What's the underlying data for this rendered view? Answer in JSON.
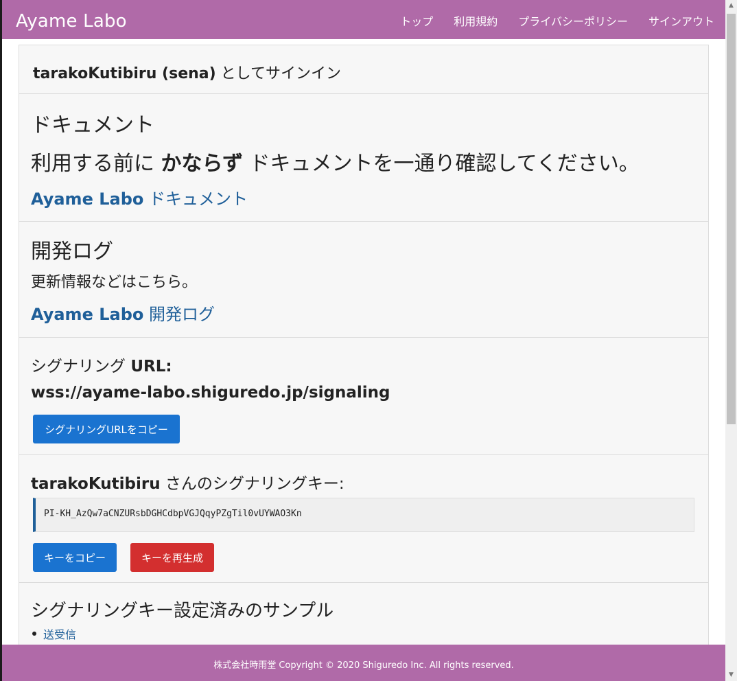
{
  "navbar": {
    "brand": "Ayame Labo",
    "links": [
      "トップ",
      "利用規約",
      "プライバシーポリシー",
      "サインアウト"
    ]
  },
  "header": {
    "user": "tarakoKutibiru (sena)",
    "suffix": " としてサインイン"
  },
  "docs": {
    "title": "ドキュメント",
    "desc_before": "利用する前に ",
    "desc_bold": "かならず",
    "desc_after": " ドキュメントを一通り確認してください。",
    "link_latin": "Ayame Labo",
    "link_jp": " ドキュメント"
  },
  "devlog": {
    "title": "開発ログ",
    "desc": "更新情報などはこちら。",
    "link_latin": "Ayame Labo",
    "link_jp": " 開発ログ"
  },
  "signaling_url": {
    "label_jp": "シグナリング ",
    "label_latin": "URL:",
    "value": "wss://ayame-labo.shiguredo.jp/signaling",
    "copy_button": "シグナリングURLをコピー"
  },
  "signaling_key": {
    "user": "tarakoKutibiru",
    "label_suffix": " さんのシグナリングキー:",
    "key": "PI-KH_AzQw7aCNZURsbDGHCdbpVGJQqyPZgTil0vUYWAO3Kn",
    "copy_button": "キーをコピー",
    "regen_button": "キーを再生成"
  },
  "samples": {
    "title": "シグナリングキー設定済みのサンプル",
    "items": [
      "送受信"
    ]
  },
  "footer": {
    "text": "株式会社時雨堂 Copyright © 2020 Shiguredo Inc. All rights reserved."
  },
  "colors": {
    "brand": "#b06aa8",
    "primary": "#1a73d0",
    "danger": "#d32f2f",
    "link": "#1f5f99"
  }
}
